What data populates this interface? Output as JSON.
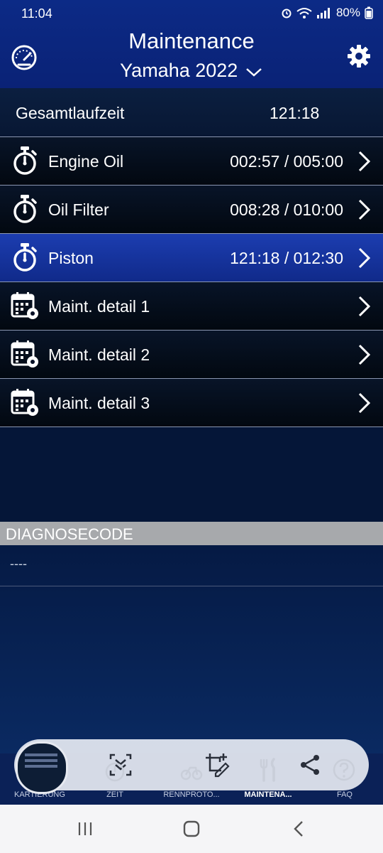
{
  "status": {
    "time": "11:04",
    "battery": "80%"
  },
  "header": {
    "title": "Maintenance",
    "subtitle": "Yamaha 2022",
    "left_icon": "speedometer-icon",
    "right_icon": "gear-icon"
  },
  "runtime": {
    "label": "Gesamtlaufzeit",
    "value": "121:18"
  },
  "items": [
    {
      "label": "Engine Oil",
      "value": "002:57 / 005:00",
      "icon": "stopwatch-icon"
    },
    {
      "label": "Oil Filter",
      "value": "008:28 / 010:00",
      "icon": "stopwatch-icon"
    },
    {
      "label": "Piston",
      "value": "121:18 / 012:30",
      "icon": "stopwatch-icon",
      "selected": true
    },
    {
      "label": "Maint. detail 1",
      "value": "",
      "icon": "calendar-gear-icon"
    },
    {
      "label": "Maint. detail 2",
      "value": "",
      "icon": "calendar-gear-icon"
    },
    {
      "label": "Maint. detail 3",
      "value": "",
      "icon": "calendar-gear-icon"
    }
  ],
  "diagnose": {
    "header": "DIAGNOSECODE",
    "value": "----"
  },
  "nav": [
    {
      "label": "KARTIERUNG"
    },
    {
      "label": "ZEIT"
    },
    {
      "label": "RENNPROTO..."
    },
    {
      "label": "MAINTENA...",
      "active": true
    },
    {
      "label": "FAQ"
    }
  ],
  "colors": {
    "header": "#0c2a86",
    "selected_row": "#1c3db0",
    "background": "#051638",
    "diag_header": "#a7a9ac"
  }
}
